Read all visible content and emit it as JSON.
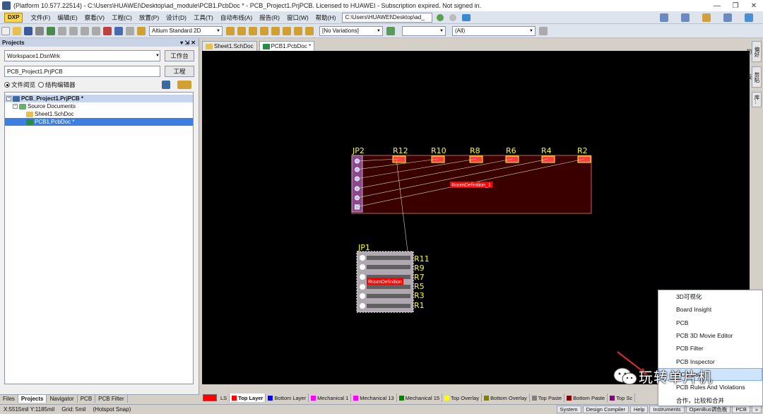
{
  "window": {
    "title": "(Platform 10.577.22514) - C:\\Users\\HUAWEI\\Desktop\\ad_module\\PCB1.PcbDoc * - PCB_Project1.PrjPCB. Licensed to HUAWEI - Subscription expired. Not signed in.",
    "minimize": "—",
    "restore": "❐",
    "close": "✕"
  },
  "menu": {
    "dxp": "DXP",
    "items": [
      "文件(F)",
      "编辑(E)",
      "察看(V)",
      "工程(C)",
      "放置(P)",
      "设计(D)",
      "工具(T)",
      "自动布线(A)",
      "报告(R)",
      "窗口(W)",
      "帮助(H)"
    ],
    "path": "C:\\Users\\HUAWEI\\Desktop\\ad_"
  },
  "toolbar": {
    "view_mode": "Altium Standard 2D",
    "variations": "[No Variations]",
    "filter": "",
    "all": "(All)"
  },
  "projects_panel": {
    "title": "Projects",
    "controls": "▾ ⇲ ✕",
    "workspace": "Workspace1.DsnWrk",
    "workspace_btn": "工作台",
    "project": "PCB_Project1.PrjPCB",
    "project_btn": "工程",
    "radio_file": "文件阅览",
    "radio_struct": "结构编辑器",
    "tree": [
      {
        "label": "PCB_Project1.PrjPCB *",
        "level": 0
      },
      {
        "label": "Source Documents",
        "level": 1
      },
      {
        "label": "Sheet1.SchDoc",
        "level": 2
      },
      {
        "label": "PCB1.PcbDoc *",
        "level": 2
      }
    ]
  },
  "bottom_tabs": [
    "Files",
    "Projects",
    "Navigator",
    "PCB",
    "PCB Filter"
  ],
  "doc_tabs": [
    "Sheet1.SchDoc",
    "PCB1.PcbDoc *"
  ],
  "right_side": [
    "偏好的",
    "剪贴板",
    "库..."
  ],
  "pcb": {
    "top_labels": [
      "JP2",
      "R12",
      "R10",
      "R8",
      "R6",
      "R4",
      "R2"
    ],
    "room1": "RoomDefinition_1",
    "jp1": "JP1",
    "side_labels": [
      "R11",
      "R9",
      "R7",
      "R5",
      "R3",
      "R1"
    ],
    "room2": "RoomDefinition"
  },
  "layers": [
    {
      "name": "LS",
      "color": "#ff0000"
    },
    {
      "name": "Top Layer",
      "color": "#ff0000"
    },
    {
      "name": "Bottom Layer",
      "color": "#0000ff"
    },
    {
      "name": "Mechanical 1",
      "color": "#ff00ff"
    },
    {
      "name": "Mechanical 13",
      "color": "#ff00ff"
    },
    {
      "name": "Mechanical 15",
      "color": "#008000"
    },
    {
      "name": "Top Overlay",
      "color": "#ffff00"
    },
    {
      "name": "Bottom Overlay",
      "color": "#808000"
    },
    {
      "name": "Top Paste",
      "color": "#808080"
    },
    {
      "name": "Bottom Paste",
      "color": "#800000"
    },
    {
      "name": "Top Sc",
      "color": "#800080"
    }
  ],
  "status": {
    "coords": "X:5515mil Y:1185mil",
    "grid": "Grid: 5mil",
    "snap": "(Hotspot Snap)",
    "buttons": [
      "System",
      "Design Compiler",
      "Help",
      "Instruments",
      "OpenBus调色板",
      "PCB",
      "»"
    ]
  },
  "popup": {
    "items": [
      "3D可视化",
      "Board Insight",
      "PCB",
      "PCB 3D Movie Editor",
      "PCB Filter",
      "PCB Inspector",
      "PCB List",
      "PCB Rules And Violations",
      "合作，比较和合并"
    ],
    "selected_index": 6
  },
  "watermark": {
    "text": "玩转单片机"
  }
}
